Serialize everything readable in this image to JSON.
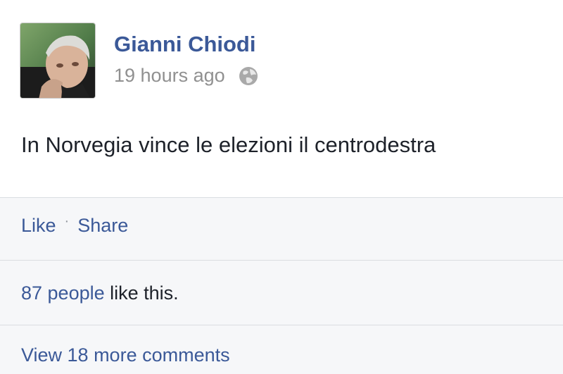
{
  "post": {
    "author": "Gianni Chiodi",
    "timestamp": "19 hours ago",
    "privacy_icon": "globe-icon",
    "text": "In Norvegia vince le elezioni il centrodestra"
  },
  "actions": {
    "like_label": "Like",
    "separator": "·",
    "share_label": "Share"
  },
  "likes": {
    "count_text": "87 people",
    "suffix": " like this."
  },
  "comments": {
    "view_more": "View 18 more comments"
  },
  "colors": {
    "link": "#3b5998",
    "muted": "#909090",
    "text": "#1d2129",
    "footer_bg": "#f6f7f9"
  }
}
